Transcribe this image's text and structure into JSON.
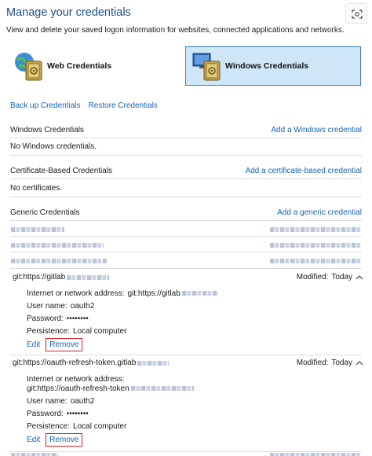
{
  "header": {
    "title": "Manage your credentials",
    "subtitle": "View and delete your saved logon information for websites, connected applications and networks."
  },
  "tiles": {
    "web": "Web Credentials",
    "windows": "Windows Credentials"
  },
  "links": {
    "backup": "Back up Credentials",
    "restore": "Restore Credentials"
  },
  "sections": {
    "windows": {
      "title": "Windows Credentials",
      "add": "Add a Windows credential",
      "empty": "No Windows credentials."
    },
    "certificate": {
      "title": "Certificate-Based Credentials",
      "add": "Add a certificate-based credential",
      "empty": "No certificates."
    },
    "generic": {
      "title": "Generic Credentials",
      "add": "Add a generic credential"
    }
  },
  "credentials": [
    {
      "name": "git:https://gitlab",
      "modified_label": "Modified:",
      "modified_value": "Today",
      "address_label": "Internet or network address:",
      "address_value": "git:https://gitlab",
      "username_label": "User name:",
      "username_value": "oauth2",
      "password_label": "Password:",
      "password_value": "••••••••",
      "persistence_label": "Persistence:",
      "persistence_value": "Local computer",
      "edit": "Edit",
      "remove": "Remove"
    },
    {
      "name": "git:https://oauth-refresh-token.gitlab",
      "modified_label": "Modified:",
      "modified_value": "Today",
      "address_label": "Internet or network address:",
      "address_value": "git:https://oauth-refresh-token",
      "username_label": "User name:",
      "username_value": "oauth2",
      "password_label": "Password:",
      "password_value": "••••••••",
      "persistence_label": "Persistence:",
      "persistence_value": "Local computer",
      "edit": "Edit",
      "remove": "Remove"
    }
  ],
  "colors": {
    "link": "#1763b6",
    "selected_tile": "#cfe6f9",
    "highlight": "#d3202a"
  },
  "icons": [
    "web-credentials-vault-icon",
    "windows-credentials-vault-icon",
    "chevron-up-icon",
    "snip-icon"
  ]
}
